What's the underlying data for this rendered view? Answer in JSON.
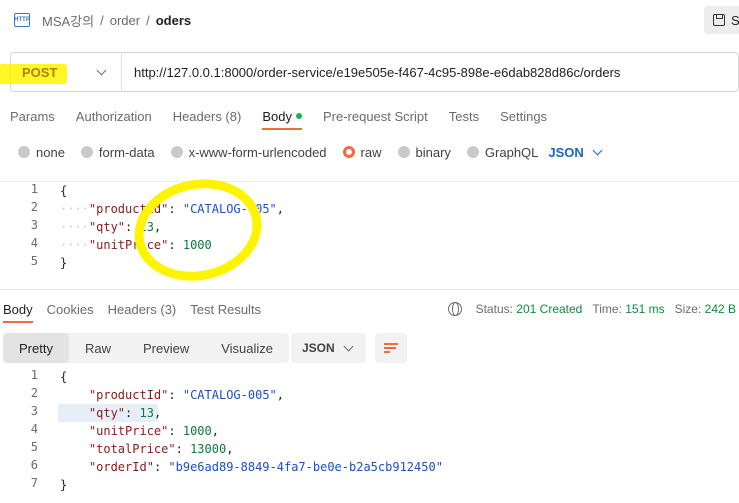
{
  "breadcrumb": {
    "icon": "HTTP",
    "items": [
      "MSA강의",
      "order",
      "oders"
    ],
    "sep": "/"
  },
  "save_label": "S",
  "request": {
    "method": "POST",
    "url": "http://127.0.0.1:8000/order-service/e19e505e-f467-4c95-898e-e6dab828d86c/orders"
  },
  "req_tabs": [
    "Params",
    "Authorization",
    "Headers (8)",
    "Body",
    "Pre-request Script",
    "Tests",
    "Settings"
  ],
  "body_types": [
    "none",
    "form-data",
    "x-www-form-urlencoded",
    "raw",
    "binary",
    "GraphQL"
  ],
  "body_format": "JSON",
  "req_body": {
    "line_numbers": [
      "1",
      "2",
      "3",
      "4",
      "5"
    ],
    "open": "{",
    "close": "}",
    "k1": "\"productId\"",
    "v1": "\"CATALOG-005\"",
    "k2": "\"qty\"",
    "v2": "13",
    "k3": "\"unitPrice\"",
    "v3": "1000"
  },
  "resp_tabs": [
    "Body",
    "Cookies",
    "Headers (3)",
    "Test Results"
  ],
  "status": {
    "status_label": "Status:",
    "status_value": "201 Created",
    "time_label": "Time:",
    "time_value": "151 ms",
    "size_label": "Size:",
    "size_value": "242 B"
  },
  "view_modes": [
    "Pretty",
    "Raw",
    "Preview",
    "Visualize"
  ],
  "resp_format": "JSON",
  "resp_body": {
    "line_numbers": [
      "1",
      "2",
      "3",
      "4",
      "5",
      "6",
      "7"
    ],
    "open": "{",
    "close": "}",
    "k1": "\"productId\"",
    "v1": "\"CATALOG-005\"",
    "k2": "\"qty\"",
    "v2": "13",
    "k3": "\"unitPrice\"",
    "v3": "1000",
    "k4": "\"totalPrice\"",
    "v4": "13000",
    "k5": "\"orderId\"",
    "v5": "\"b9e6ad89-8849-4fa7-be0e-b2a5cb912450\""
  },
  "colors": {
    "accent": "#f26b3a",
    "highlighter": "#fff400",
    "method": "#a88400",
    "link": "#1a64c8",
    "success": "#0b8c3e"
  },
  "icons": [
    "http-icon",
    "save-icon",
    "chevron-down-icon",
    "globe-icon",
    "wrap-lines-icon"
  ]
}
